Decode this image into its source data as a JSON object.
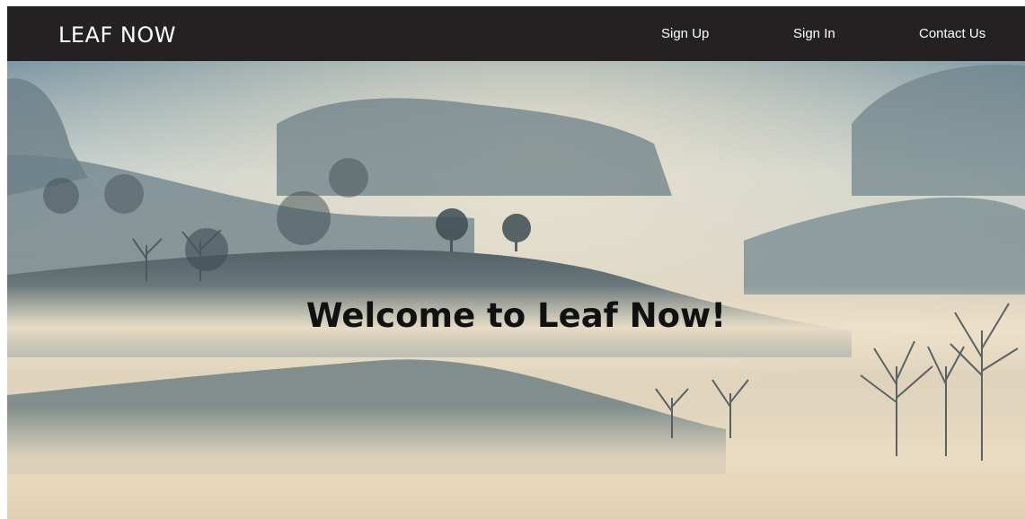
{
  "header": {
    "brand": "LEAF NOW",
    "nav": {
      "sign_up": "Sign Up",
      "sign_in": "Sign In",
      "contact_us": "Contact Us"
    }
  },
  "hero": {
    "welcome_text": "Welcome to Leaf Now!"
  },
  "colors": {
    "navbar_background": "#242122",
    "nav_text": "#ffffff",
    "hero_text": "#111111"
  }
}
